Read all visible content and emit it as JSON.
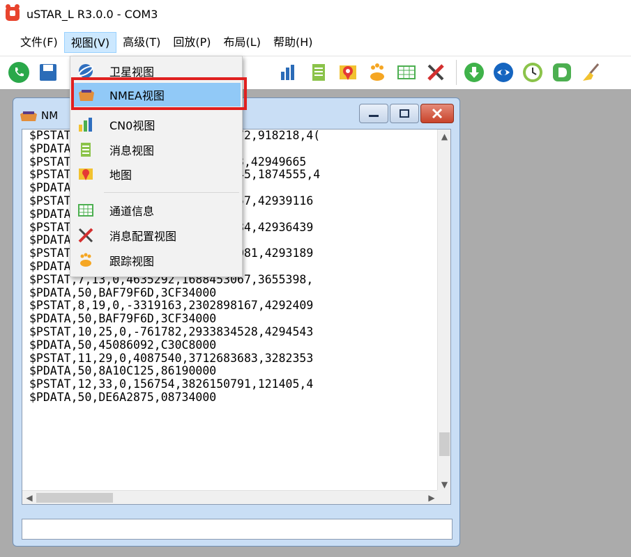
{
  "window": {
    "title": "uSTAR_L R3.0.0 - COM3"
  },
  "menubar": [
    {
      "label": "文件(F)"
    },
    {
      "label": "视图(V)"
    },
    {
      "label": "高级(T)"
    },
    {
      "label": "回放(P)"
    },
    {
      "label": "布局(L)"
    },
    {
      "label": "帮助(H)"
    }
  ],
  "toolbar": {
    "buttons": [
      "phone-icon",
      "save-icon",
      "satellite-icon",
      "nmea-view-icon",
      "cn0-chart-icon",
      "message-list-icon",
      "map-pin-icon",
      "tracking-icon",
      "channel-table-icon",
      "config-tools-icon",
      "download-icon",
      "refresh-globe-icon",
      "clock-icon",
      "d-logo-icon",
      "broom-icon"
    ]
  },
  "dropdown": {
    "items": [
      {
        "label": "卫星视图",
        "icon": "satellite-icon"
      },
      {
        "label": "NMEA视图",
        "icon": "nmea-view-icon",
        "highlighted": true
      },
      {
        "label": "CN0视图",
        "icon": "cn0-chart-icon"
      },
      {
        "label": "消息视图",
        "icon": "message-list-icon"
      },
      {
        "label": "地图",
        "icon": "map-pin-icon"
      },
      {
        "label": "通道信息",
        "icon": "channel-table-icon"
      },
      {
        "label": "消息配置视图",
        "icon": "config-tools-icon"
      },
      {
        "label": "跟踪视图",
        "icon": "tracking-icon"
      }
    ]
  },
  "child_window": {
    "title": "NM",
    "log_lines": [
      "$PSTAT,1,1,0,-2105839,1860604972,918218,4(",
      "$PDATA,50,8A10C125,86190000",
      "$PSTAT,2,3,0,-4118368,720774453,42949665",
      "$PSTAT,3,5,0,-1258907,2120516845,1874555,4",
      "$PDATA,50,8A10C125,86190000",
      "$PSTAT,4,7,0,-2271854,2576025757,42939116",
      "$PDATA,50,DE6A2875,3E6C000",
      "$PSTAT,5,9,0,-3184607,3658578184,42936439",
      "$PDATA,50,D9EF5E59,640D4000",
      "$PSTAT,6,12,0,-2350053,1206138081,4293189",
      "$PDATA,50,BAF79F6D,3CF34000",
      "$PSTAT,7,13,0,4635292,1688453067,3655398,",
      "$PDATA,50,BAF79F6D,3CF34000",
      "$PSTAT,8,19,0,-3319163,2302898167,4292409",
      "$PDATA,50,BAF79F6D,3CF34000",
      "$PSTAT,10,25,0,-761782,2933834528,4294543",
      "$PDATA,50,45086092,C30C8000",
      "$PSTAT,11,29,0,4087540,3712683683,3282353",
      "$PDATA,50,8A10C125,86190000",
      "$PSTAT,12,33,0,156754,3826150791,121405,4",
      "$PDATA,50,DE6A2875,08734000"
    ],
    "command_input": ""
  },
  "scroll": {
    "vertical_position": 0.93,
    "horizontal_position": 0.0
  }
}
